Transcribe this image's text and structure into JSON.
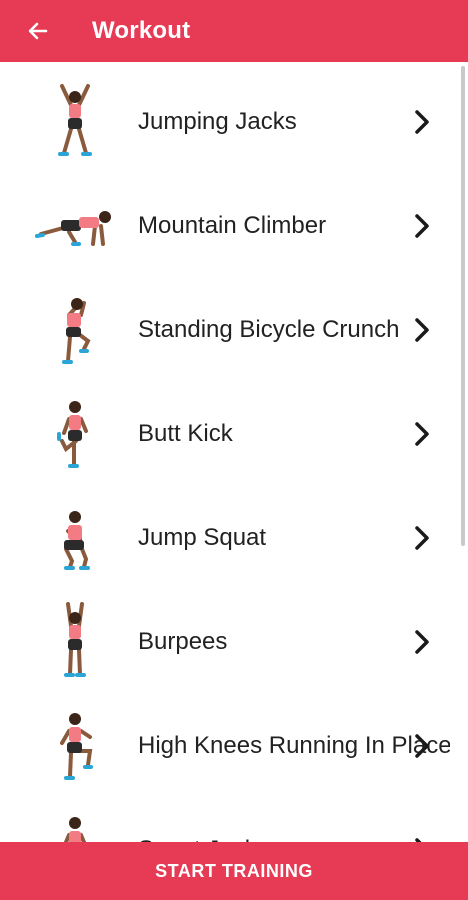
{
  "app_bar": {
    "title": "Workout",
    "back_icon": "arrow-left-icon",
    "color": "#e63a55"
  },
  "exercises": [
    {
      "name": "Jumping Jacks",
      "icon": "jumping-jacks-figure"
    },
    {
      "name": "Mountain Climber",
      "icon": "mountain-climber-figure"
    },
    {
      "name": "Standing Bicycle Crunch",
      "icon": "standing-bicycle-crunch-figure"
    },
    {
      "name": "Butt Kick",
      "icon": "butt-kick-figure"
    },
    {
      "name": "Jump Squat",
      "icon": "jump-squat-figure"
    },
    {
      "name": "Burpees",
      "icon": "burpees-figure"
    },
    {
      "name": "High Knees Running In Place",
      "icon": "high-knees-figure"
    },
    {
      "name": "Squat Jacks",
      "icon": "squat-jacks-figure"
    }
  ],
  "start_button": {
    "label": "START TRAINING",
    "color": "#e63a55"
  }
}
